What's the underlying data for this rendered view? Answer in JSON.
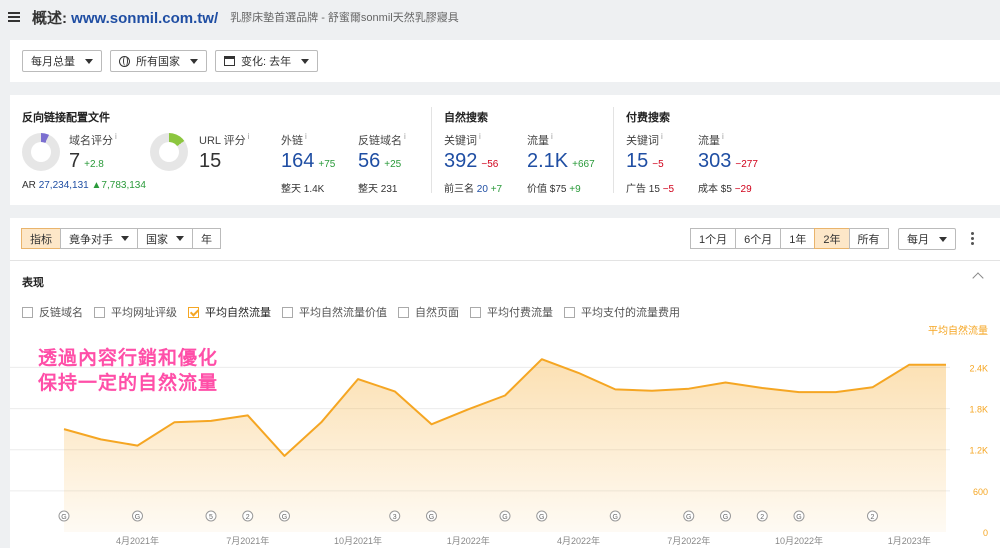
{
  "header": {
    "title_prefix": "概述:",
    "domain": "www.sonmil.com.tw/",
    "subtitle": "乳膠床墊首選品牌 - 舒蜜爾sonmil天然乳膠寢具"
  },
  "filters": {
    "period": "每月总量",
    "country": "所有国家",
    "change": "变化: 去年"
  },
  "backlinks": {
    "section_title": "反向链接配置文件",
    "dr_label": "域名评分",
    "dr_value": "7",
    "dr_delta": "+2.8",
    "ar_label": "AR",
    "ar_value": "27,234,131",
    "ar_delta": "▲7,783,134",
    "ur_label": "URL 评分",
    "ur_value": "15",
    "ext_label": "外链",
    "ext_value": "164",
    "ext_delta": "+75",
    "ext_sub_label": "整天",
    "ext_sub_value": "1.4K",
    "rd_label": "反链域名",
    "rd_value": "56",
    "rd_delta": "+25",
    "rd_sub_label": "整天",
    "rd_sub_value": "231",
    "dr_fraction": 0.07,
    "ur_fraction": 0.15,
    "dr_color": "#7b6fd0",
    "ur_color": "#8cc63f"
  },
  "organic": {
    "section_title": "自然搜索",
    "kw_label": "关键词",
    "kw_value": "392",
    "kw_delta": "−56",
    "top3_label": "前三名",
    "top3_value": "20",
    "top3_delta": "+7",
    "traffic_label": "流量",
    "traffic_value": "2.1K",
    "traffic_delta": "+667",
    "value_label": "价值",
    "value_value": "$75",
    "value_delta": "+9"
  },
  "paid": {
    "section_title": "付费搜索",
    "kw_label": "关键词",
    "kw_value": "15",
    "kw_delta": "−5",
    "ads_label": "广告",
    "ads_value": "15",
    "ads_delta": "−5",
    "traffic_label": "流量",
    "traffic_value": "303",
    "traffic_delta": "−277",
    "cost_label": "成本",
    "cost_value": "$5",
    "cost_delta": "−29"
  },
  "chart_tabs": {
    "metrics": "指标",
    "competitors": "竟争对手",
    "country": "国家",
    "year": "年"
  },
  "ranges": [
    "1个月",
    "6个月",
    "1年",
    "2年",
    "所有"
  ],
  "active_range": "2年",
  "granularity": "每月",
  "performance": {
    "title": "表现",
    "legend": [
      {
        "label": "反链域名",
        "checked": false
      },
      {
        "label": "平均网址评级",
        "checked": false
      },
      {
        "label": "平均自然流量",
        "checked": true
      },
      {
        "label": "平均自然流量价值",
        "checked": false
      },
      {
        "label": "自然页面",
        "checked": false
      },
      {
        "label": "平均付费流量",
        "checked": false
      },
      {
        "label": "平均支付的流量费用",
        "checked": false
      }
    ],
    "annotation_line1": "透過內容行銷和優化",
    "annotation_line2": "保持一定的自然流量"
  },
  "chart_data": {
    "type": "area",
    "series_name": "平均自然流量",
    "color": "#f5a623",
    "ylim": [
      0,
      2800
    ],
    "yticks": [
      600,
      1200,
      1800,
      2400
    ],
    "ytick_labels": [
      "600",
      "1.2K",
      "1.8K",
      "2.4K"
    ],
    "y_zero_label": "0",
    "x": [
      "2021-01",
      "2021-02",
      "2021-03",
      "2021-04",
      "2021-05",
      "2021-06",
      "2021-07",
      "2021-08",
      "2021-09",
      "2021-10",
      "2021-11",
      "2021-12",
      "2022-01",
      "2022-02",
      "2022-03",
      "2022-04",
      "2022-05",
      "2022-06",
      "2022-07",
      "2022-08",
      "2022-09",
      "2022-10",
      "2022-11",
      "2022-12",
      "2023-01"
    ],
    "values": [
      1500,
      1350,
      1260,
      1600,
      1620,
      1700,
      1110,
      1600,
      2230,
      2050,
      1570,
      1790,
      1990,
      2520,
      2320,
      2080,
      2060,
      2090,
      2180,
      2100,
      2040,
      2040,
      2110,
      2440,
      2440
    ],
    "xtick_labels": [
      {
        "label": "4月2021年",
        "index": 2
      },
      {
        "label": "7月2021年",
        "index": 5
      },
      {
        "label": "10月2021年",
        "index": 8
      },
      {
        "label": "1月2022年",
        "index": 11
      },
      {
        "label": "4月2022年",
        "index": 14
      },
      {
        "label": "7月2022年",
        "index": 17
      },
      {
        "label": "10月2022年",
        "index": 20
      },
      {
        "label": "1月2023年",
        "index": 23
      }
    ],
    "markers": [
      {
        "index": 0,
        "label": "G"
      },
      {
        "index": 2,
        "label": "G"
      },
      {
        "index": 4,
        "label": "5"
      },
      {
        "index": 5,
        "label": "2"
      },
      {
        "index": 6,
        "label": "G"
      },
      {
        "index": 9,
        "label": "3"
      },
      {
        "index": 10,
        "label": "G"
      },
      {
        "index": 12,
        "label": "G"
      },
      {
        "index": 13,
        "label": "G"
      },
      {
        "index": 15,
        "label": "G"
      },
      {
        "index": 17,
        "label": "G"
      },
      {
        "index": 18,
        "label": "G"
      },
      {
        "index": 19,
        "label": "2"
      },
      {
        "index": 20,
        "label": "G"
      },
      {
        "index": 22,
        "label": "2"
      }
    ]
  }
}
